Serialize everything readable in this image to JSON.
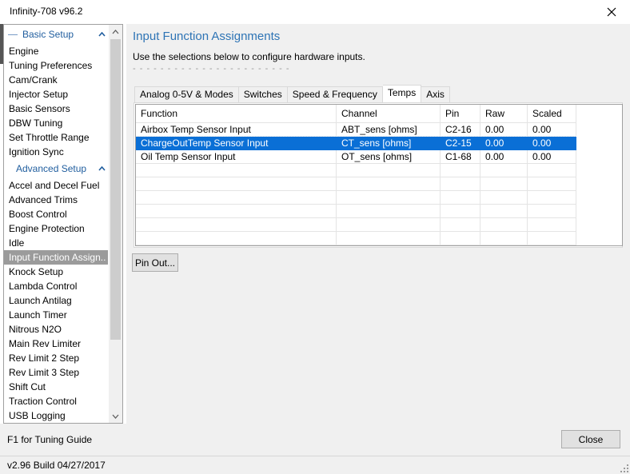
{
  "window": {
    "title": "Infinity-708 v96.2"
  },
  "sidebar": {
    "sections": [
      {
        "title": "Basic Setup",
        "items": [
          "Engine",
          "Tuning Preferences",
          "Cam/Crank",
          "Injector Setup",
          "Basic Sensors",
          "DBW Tuning",
          "Set Throttle Range",
          "Ignition Sync"
        ]
      },
      {
        "title": "Advanced Setup",
        "items": [
          "Accel and Decel Fuel",
          "Advanced Trims",
          "Boost Control",
          "Engine Protection",
          "Idle",
          "Input Function Assign..",
          "Knock Setup",
          "Lambda Control",
          "Launch Antilag",
          "Launch Timer",
          "Nitrous N2O",
          "Main Rev Limiter",
          "Rev Limit 2 Step",
          "Rev Limit 3 Step",
          "Shift Cut",
          "Traction Control",
          "USB Logging"
        ]
      }
    ],
    "selected_item": "Input Function Assign.."
  },
  "content": {
    "heading": "Input Function Assignments",
    "description": "Use the selections below to configure hardware inputs.",
    "dashes": "- - - - - - - - - - - - - - - - - - - - - - -",
    "tabs": [
      "Analog 0-5V & Modes",
      "Switches",
      "Speed & Frequency",
      "Temps",
      "Axis"
    ],
    "active_tab": "Temps",
    "table": {
      "columns": [
        "Function",
        "Channel",
        "Pin",
        "Raw",
        "Scaled"
      ],
      "rows": [
        [
          "Airbox Temp Sensor Input",
          "ABT_sens [ohms]",
          "C2-16",
          "0.00",
          "0.00"
        ],
        [
          "ChargeOutTemp Sensor Input",
          "CT_sens [ohms]",
          "C2-15",
          "0.00",
          "0.00"
        ],
        [
          "Oil Temp Sensor Input",
          "OT_sens [ohms]",
          "C1-68",
          "0.00",
          "0.00"
        ]
      ],
      "selected_row": 1,
      "empty_rows": 6
    },
    "pin_out_label": "Pin Out..."
  },
  "footer": {
    "hint": "F1 for Tuning Guide",
    "close_label": "Close"
  },
  "statusbar": {
    "version": "v2.96 Build 04/27/2017"
  },
  "colors": {
    "accent": "#2e74b5",
    "selection": "#0a6fd6",
    "sidebar_selected": "#9b9b9b"
  },
  "icons": {
    "close": "close-icon",
    "collapse": "chevron-up-icon",
    "scroll_up": "arrow-up-icon",
    "scroll_down": "arrow-down-icon",
    "grip": "resize-grip-icon"
  }
}
